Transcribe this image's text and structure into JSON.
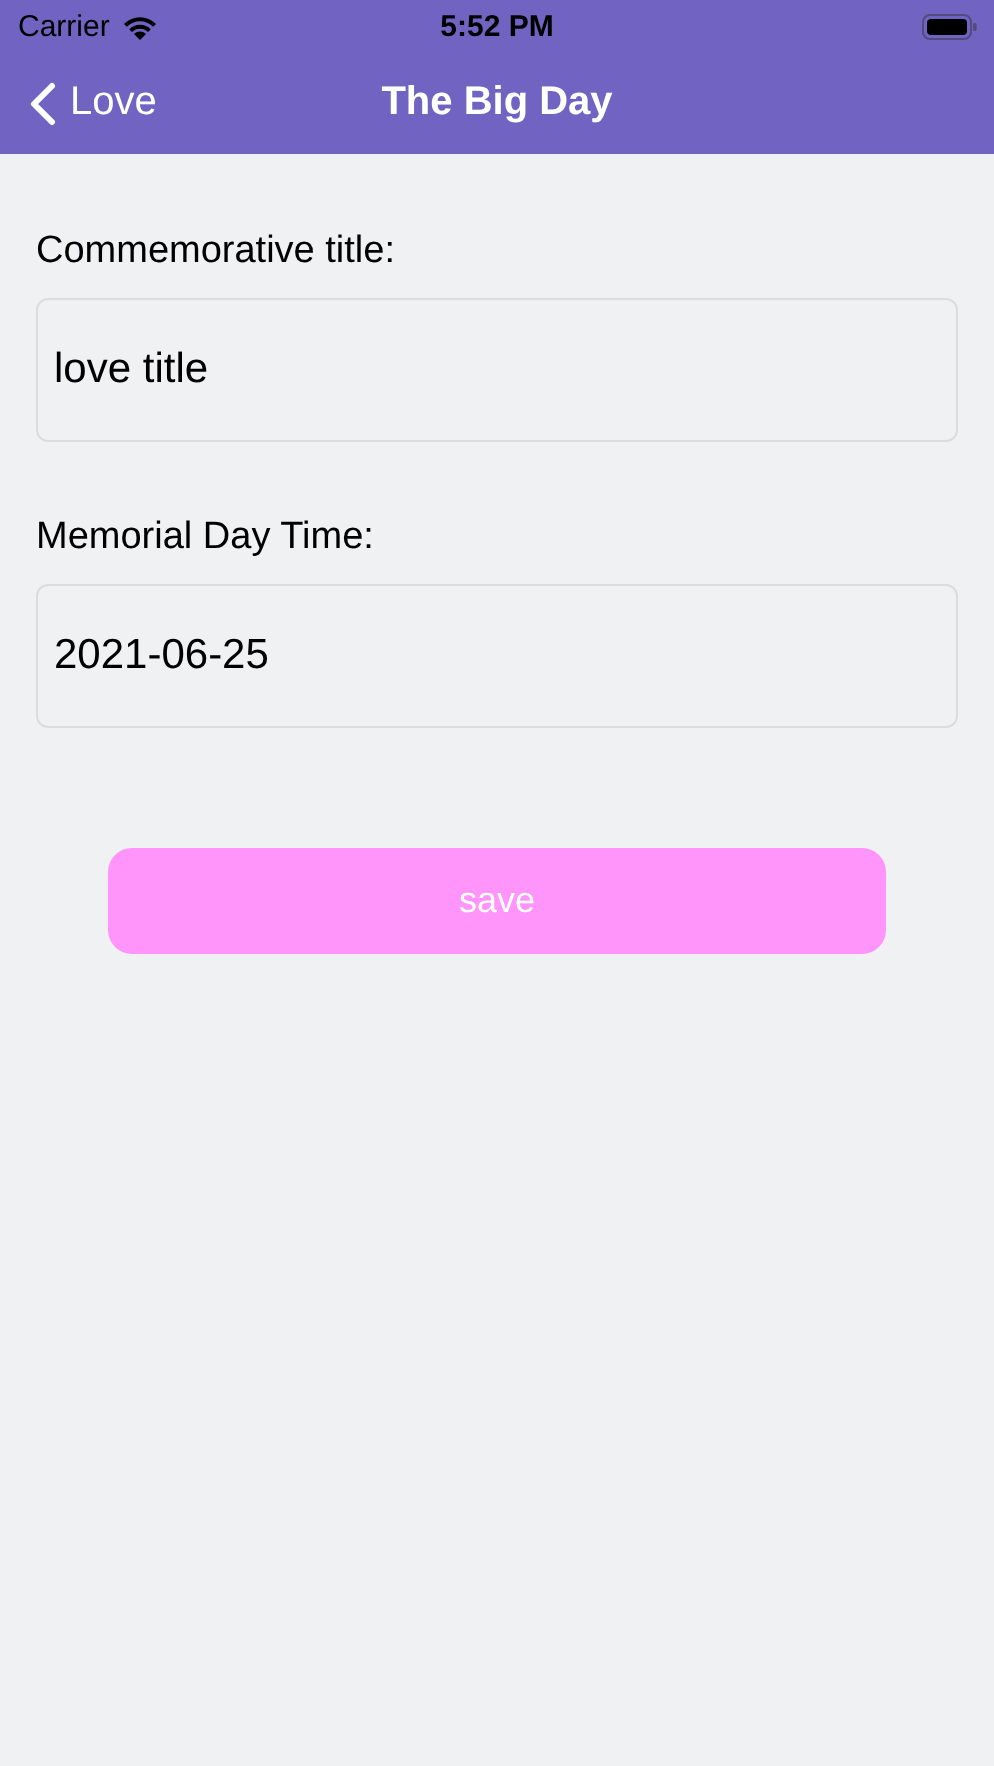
{
  "status_bar": {
    "carrier": "Carrier",
    "time": "5:52 PM"
  },
  "nav_bar": {
    "back": "Love",
    "title": "The Big Day"
  },
  "fields": [
    {
      "label": "Commemorative title:",
      "value": "love title"
    },
    {
      "label": "Memorial Day Time:",
      "value": "2021-06-25"
    }
  ],
  "save_button": {
    "label": "save"
  }
}
